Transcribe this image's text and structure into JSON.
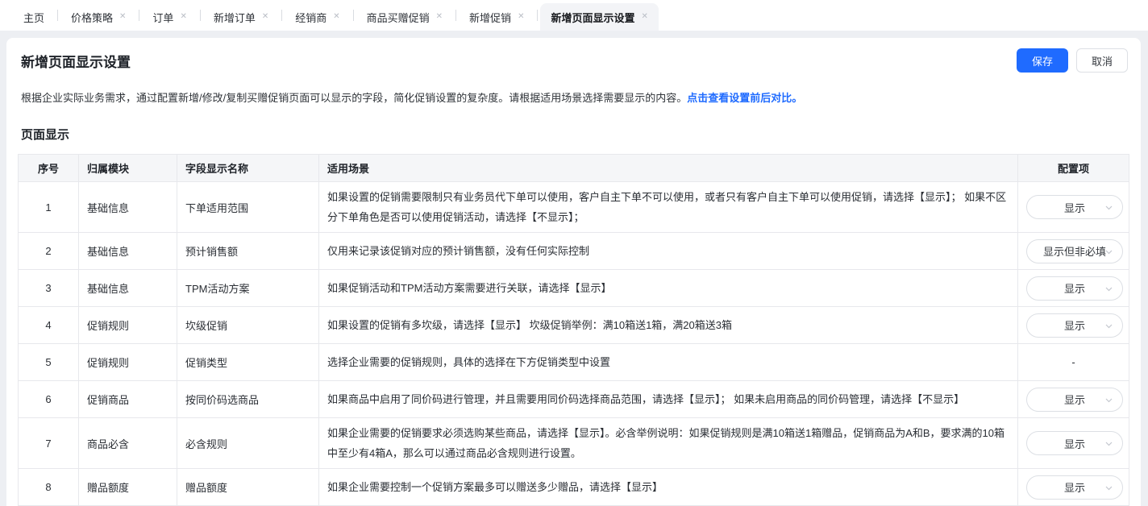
{
  "tabs": [
    {
      "label": "主页",
      "closable": false,
      "active": false
    },
    {
      "label": "价格策略",
      "closable": true,
      "active": false
    },
    {
      "label": "订单",
      "closable": true,
      "active": false
    },
    {
      "label": "新增订单",
      "closable": true,
      "active": false
    },
    {
      "label": "经销商",
      "closable": true,
      "active": false
    },
    {
      "label": "商品买赠促销",
      "closable": true,
      "active": false
    },
    {
      "label": "新增促销",
      "closable": true,
      "active": false
    },
    {
      "label": "新增页面显示设置",
      "closable": true,
      "active": true
    }
  ],
  "header": {
    "title": "新增页面显示设置",
    "save_label": "保存",
    "cancel_label": "取消"
  },
  "description": {
    "text": "根据企业实际业务需求，通过配置新增/修改/复制买赠促销页面可以显示的字段，简化促销设置的复杂度。请根据适用场景选择需要显示的内容。",
    "link": "点击查看设置前后对比。"
  },
  "section_title": "页面显示",
  "table": {
    "columns": [
      "序号",
      "归属模块",
      "字段显示名称",
      "适用场景",
      "配置项"
    ],
    "rows": [
      {
        "no": "1",
        "module": "基础信息",
        "field": "下单适用范围",
        "scenario": "如果设置的促销需要限制只有业务员代下单可以使用，客户自主下单不可以使用，或者只有客户自主下单可以使用促销，请选择【显示】； 如果不区分下单角色是否可以使用促销活动，请选择【不显示】；",
        "config": "显示",
        "config_type": "select"
      },
      {
        "no": "2",
        "module": "基础信息",
        "field": "预计销售额",
        "scenario": "仅用来记录该促销对应的预计销售额，没有任何实际控制",
        "config": "显示但非必填",
        "config_type": "select"
      },
      {
        "no": "3",
        "module": "基础信息",
        "field": "TPM活动方案",
        "scenario": "如果促销活动和TPM活动方案需要进行关联，请选择【显示】",
        "config": "显示",
        "config_type": "select"
      },
      {
        "no": "4",
        "module": "促销规则",
        "field": "坎级促销",
        "scenario": "如果设置的促销有多坎级，请选择【显示】 坎级促销举例：满10箱送1箱，满20箱送3箱",
        "config": "显示",
        "config_type": "select"
      },
      {
        "no": "5",
        "module": "促销规则",
        "field": "促销类型",
        "scenario": "选择企业需要的促销规则，具体的选择在下方促销类型中设置",
        "config": "-",
        "config_type": "text"
      },
      {
        "no": "6",
        "module": "促销商品",
        "field": "按同价码选商品",
        "scenario": "如果商品中启用了同价码进行管理，并且需要用同价码选择商品范围，请选择【显示】； 如果未启用商品的同价码管理，请选择【不显示】",
        "config": "显示",
        "config_type": "select"
      },
      {
        "no": "7",
        "module": "商品必含",
        "field": "必含规则",
        "scenario": "如果企业需要的促销要求必须选购某些商品，请选择【显示】。必含举例说明：如果促销规则是满10箱送1箱赠品，促销商品为A和B，要求满的10箱中至少有4箱A，那么可以通过商品必含规则进行设置。",
        "config": "显示",
        "config_type": "select"
      },
      {
        "no": "8",
        "module": "赠品额度",
        "field": "赠品额度",
        "scenario": "如果企业需要控制一个促销方案最多可以赠送多少赠品，请选择【显示】",
        "config": "显示",
        "config_type": "select"
      }
    ]
  },
  "colors": {
    "accent": "#1f6bff",
    "page_background": "#edeff3",
    "table_header_background": "#f5f6f8",
    "table_border": "#e7e8ec",
    "active_tab_background": "#f3f4f7"
  },
  "icons": {
    "tab_close": "close-icon ✕",
    "config_dropdown": "chevron-down-icon ∨"
  }
}
